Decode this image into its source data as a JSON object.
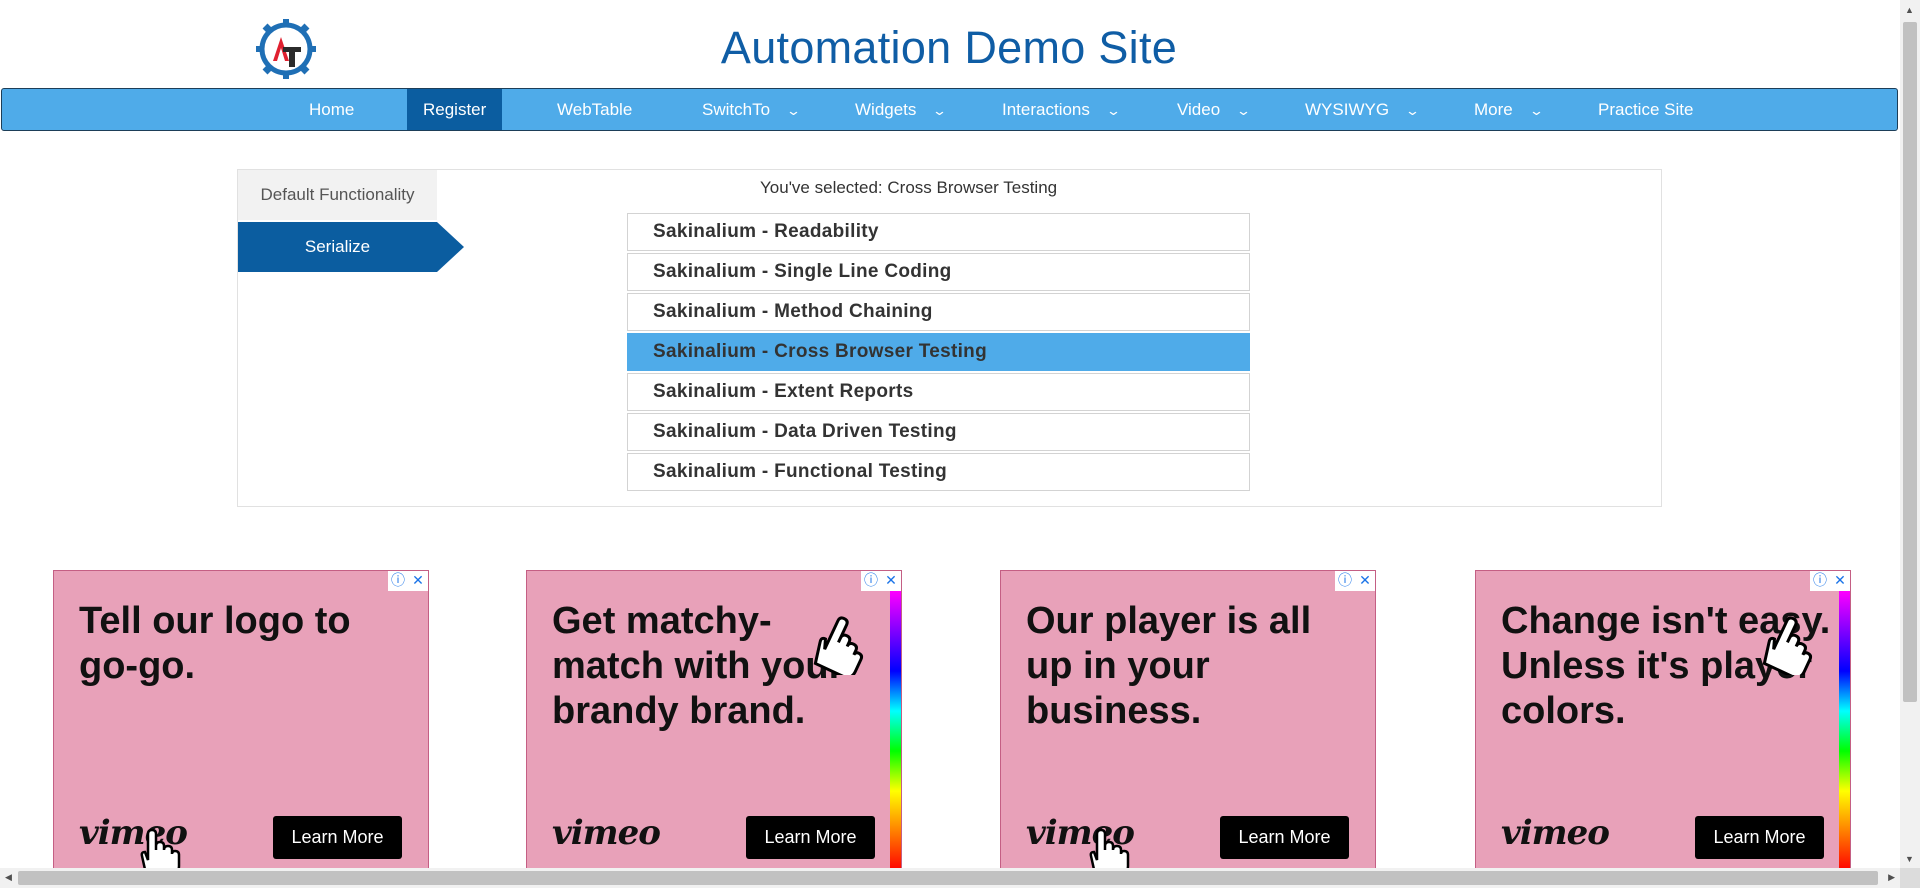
{
  "header": {
    "title": "Automation Demo Site",
    "logo_text": "AT"
  },
  "nav": {
    "items": [
      {
        "label": "Home",
        "dropdown": false
      },
      {
        "label": "Register",
        "dropdown": false,
        "active": true
      },
      {
        "label": "WebTable",
        "dropdown": false
      },
      {
        "label": "SwitchTo",
        "dropdown": true
      },
      {
        "label": "Widgets",
        "dropdown": true
      },
      {
        "label": "Interactions",
        "dropdown": true
      },
      {
        "label": "Video",
        "dropdown": true
      },
      {
        "label": "WYSIWYG",
        "dropdown": true
      },
      {
        "label": "More",
        "dropdown": true
      },
      {
        "label": "Practice Site",
        "dropdown": false
      }
    ],
    "caret": "⌄"
  },
  "tabs": {
    "default_label": "Default Functionality",
    "serialize_label": "Serialize",
    "active": "Serialize"
  },
  "selectable": {
    "status_text": "You've selected: Cross Browser Testing",
    "items": [
      {
        "label": "Sakinalium - Readability",
        "selected": false
      },
      {
        "label": "Sakinalium - Single Line Coding",
        "selected": false
      },
      {
        "label": "Sakinalium - Method Chaining",
        "selected": false
      },
      {
        "label": "Sakinalium - Cross Browser Testing",
        "selected": true
      },
      {
        "label": "Sakinalium - Extent Reports",
        "selected": false
      },
      {
        "label": "Sakinalium - Data Driven Testing",
        "selected": false
      },
      {
        "label": "Sakinalium - Functional Testing",
        "selected": false
      }
    ]
  },
  "ads": [
    {
      "headline": "Tell our logo to go-go.",
      "brand": "vimeo",
      "button": "Learn More"
    },
    {
      "headline": "Get matchy-match with your brandy brand.",
      "brand": "vimeo",
      "button": "Learn More"
    },
    {
      "headline": "Our player is all up in your business.",
      "brand": "vimeo",
      "button": "Learn More"
    },
    {
      "headline": "Change isn't easy. Unless it's player colors.",
      "brand": "vimeo",
      "button": "Learn More"
    }
  ],
  "ad_controls": {
    "info": "ⓘ",
    "close": "✕"
  },
  "colors": {
    "nav_bg": "#4fabe9",
    "accent": "#0b5da0",
    "title": "#0f5da5",
    "selected_item": "#4fabe9",
    "ad_bg": "#e8a1b9"
  }
}
